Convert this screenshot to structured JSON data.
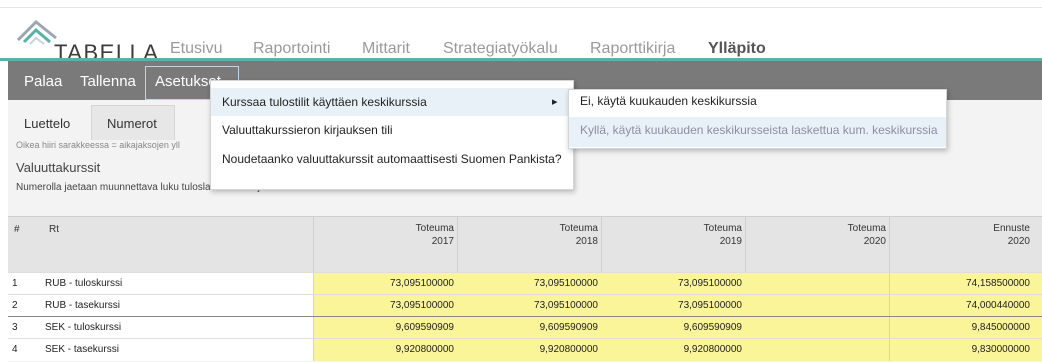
{
  "brand": {
    "name": "TABELLA"
  },
  "nav": [
    "Etusivu",
    "Raportointi",
    "Mittarit",
    "Strategiatyökalu",
    "Raporttikirja",
    "Ylläpito"
  ],
  "toolbar": {
    "back": "Palaa",
    "save": "Tallenna",
    "settings": "Asetukset"
  },
  "tabs": [
    "Luettelo",
    "Numerot"
  ],
  "hint": "Oikea hiiri sarakkeessa = aikajaksojen yll",
  "page_title": "Valuuttakurssit",
  "page_subtitle": "Numerolla jaetaan muunnettava luku tuloslaskelmatili- ja tasetiliksi",
  "grid": {
    "col_hash": "#",
    "col_rt": "Rt",
    "columns": [
      {
        "l1": "Toteuma",
        "l2": "2017"
      },
      {
        "l1": "Toteuma",
        "l2": "2018"
      },
      {
        "l1": "Toteuma",
        "l2": "2019"
      },
      {
        "l1": "Toteuma",
        "l2": "2020"
      },
      {
        "l1": "Ennuste",
        "l2": "2020"
      }
    ],
    "rows": [
      {
        "n": "1",
        "rt": "RUB - tuloskurssi",
        "v": [
          "73,095100000",
          "73,095100000",
          "73,095100000",
          "",
          "74,158500000"
        ]
      },
      {
        "n": "2",
        "rt": "RUB - tasekurssi",
        "v": [
          "73,095100000",
          "73,095100000",
          "73,095100000",
          "",
          "74,000440000"
        ]
      },
      {
        "n": "3",
        "rt": "SEK - tuloskurssi",
        "v": [
          "9,609590909",
          "9,609590909",
          "9,609590909",
          "",
          "9,845000000"
        ]
      },
      {
        "n": "4",
        "rt": "SEK - tasekurssi",
        "v": [
          "9,920800000",
          "9,920800000",
          "9,920800000",
          "",
          "9,830000000"
        ]
      }
    ]
  },
  "menu": {
    "items": [
      "Kurssaa tulostilit käyttäen keskikurssia",
      "Valuuttakurssieron kirjauksen tili",
      "Noudetaanko valuuttakurssit automaattisesti Suomen Pankista?"
    ],
    "arrow": "▸",
    "submenu": [
      "Ei, käytä kuukauden keskikurssia",
      "Kyllä, käytä kuukauden keskikursseista laskettua kum. keskikurssia"
    ]
  }
}
